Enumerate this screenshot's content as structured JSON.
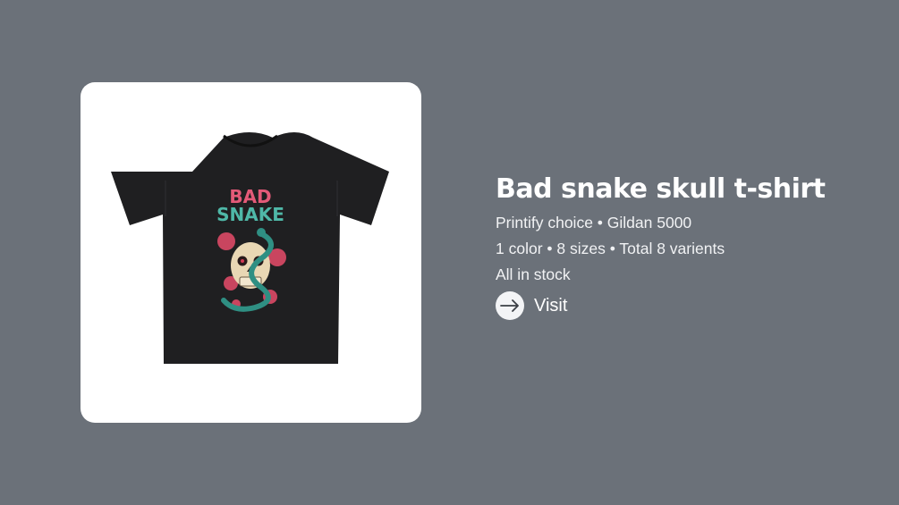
{
  "product": {
    "title": "Bad snake skull t-shirt",
    "provider_line": "Printify choice • Gildan 5000",
    "variants_line": "1 color • 8 sizes • Total 8 varients",
    "stock_line": "All in stock",
    "visit_label": "Visit",
    "image": {
      "icon": "tshirt-product-image",
      "shirt_color": "#1f1f21",
      "graphic_text_top": "BAD",
      "graphic_text_bottom": "SNAKE",
      "graphic_text_colors": [
        "#e45a78",
        "#4fb8a8"
      ]
    }
  },
  "colors": {
    "background": "#6b7179",
    "card": "#ffffff",
    "text": "#ffffff"
  }
}
